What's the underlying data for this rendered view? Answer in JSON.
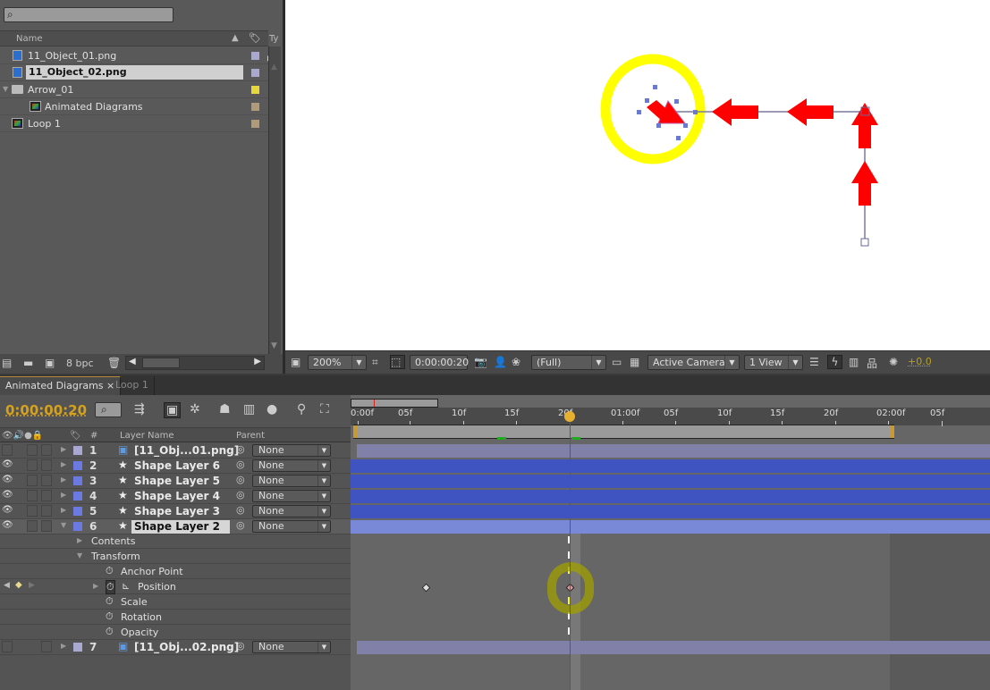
{
  "project": {
    "search_placeholder": "",
    "columns": {
      "name": "Name",
      "type": "Ty"
    },
    "items": [
      {
        "label": "11_Object_01.png",
        "type": "footage",
        "label_color": "#a8a8d0",
        "selected": false
      },
      {
        "label": "11_Object_02.png",
        "type": "footage",
        "label_color": "#a8a8d0",
        "selected": true
      },
      {
        "label": "Arrow_01",
        "type": "folder",
        "label_color": "#e6d83c",
        "selected": false
      },
      {
        "label": "Animated Diagrams",
        "type": "composition",
        "label_color": "#b09a78",
        "selected": false
      },
      {
        "label": "Loop 1",
        "type": "composition",
        "label_color": "#b09a78",
        "selected": false
      }
    ],
    "bit_depth": "8 bpc"
  },
  "viewer": {
    "magnification": "200%",
    "timecode": "0:00:00:20",
    "resolution": "(Full)",
    "camera": "Active Camera",
    "views": "1 View",
    "exposure": "+0.0"
  },
  "tabs": [
    {
      "label": "Animated Diagrams",
      "active": true,
      "close": "×"
    },
    {
      "label": "Loop 1",
      "active": false
    }
  ],
  "timeline": {
    "current_time": "0:00:00:20",
    "columns": {
      "number": "#",
      "layer_name": "Layer Name",
      "parent": "Parent"
    },
    "ruler_ticks": [
      "0:00f",
      "05f",
      "10f",
      "15f",
      "20f",
      "01:00f",
      "05f",
      "10f",
      "15f",
      "20f",
      "02:00f",
      "05f"
    ],
    "layers": [
      {
        "num": "1",
        "name": "[11_Obj...01.png]",
        "type": "footage",
        "label_color": "#a8a8d0",
        "parent": "None",
        "visible": false,
        "selected": false,
        "expanded": false
      },
      {
        "num": "2",
        "name": "Shape Layer 6",
        "type": "shape",
        "label_color": "#6a7ae0",
        "parent": "None",
        "visible": true,
        "selected": false,
        "expanded": false
      },
      {
        "num": "3",
        "name": "Shape Layer 5",
        "type": "shape",
        "label_color": "#6a7ae0",
        "parent": "None",
        "visible": true,
        "selected": false,
        "expanded": false
      },
      {
        "num": "4",
        "name": "Shape Layer 4",
        "type": "shape",
        "label_color": "#6a7ae0",
        "parent": "None",
        "visible": true,
        "selected": false,
        "expanded": false
      },
      {
        "num": "5",
        "name": "Shape Layer 3",
        "type": "shape",
        "label_color": "#6a7ae0",
        "parent": "None",
        "visible": true,
        "selected": false,
        "expanded": false
      },
      {
        "num": "6",
        "name": "Shape Layer 2",
        "type": "shape",
        "label_color": "#6a7ae0",
        "parent": "None",
        "visible": true,
        "selected": true,
        "expanded": true
      }
    ],
    "properties": {
      "contents": "Contents",
      "transform": "Transform",
      "anchor_point": "Anchor Point",
      "position": "Position",
      "scale": "Scale",
      "rotation": "Rotation",
      "opacity": "Opacity"
    },
    "layer7": {
      "num": "7",
      "name": "[11_Obj...02.png]",
      "type": "footage",
      "label_color": "#a8a8d0",
      "parent": "None"
    }
  },
  "colors": {
    "accent_timecode": "#d6a21e",
    "cti": "#e02020",
    "shape_bar": "#3f54c0",
    "footage_bar": "#8080a8"
  }
}
